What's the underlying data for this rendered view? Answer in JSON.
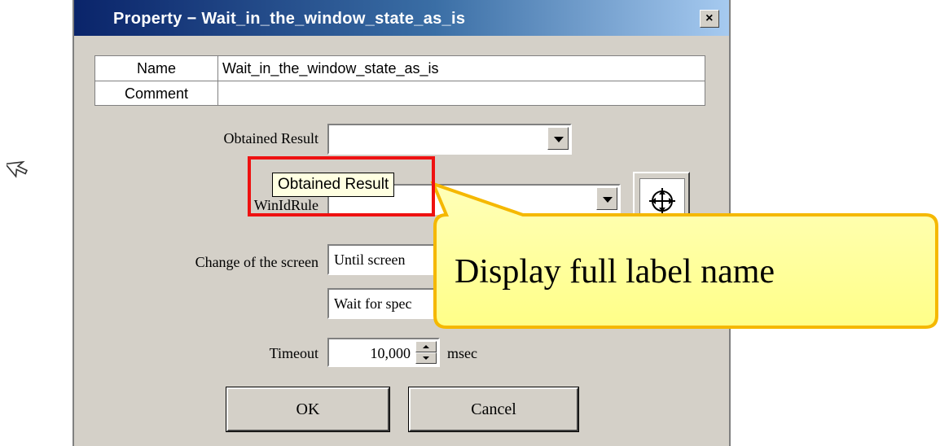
{
  "dialog": {
    "title": "Property − Wait_in_the_window_state_as_is",
    "close_label": "×"
  },
  "table": {
    "name_label": "Name",
    "name_value": "Wait_in_the_window_state_as_is",
    "comment_label": "Comment",
    "comment_value": ""
  },
  "form": {
    "obtained_result_label": "Obtained Result",
    "obtained_result_value": "",
    "winidrule_label": "WinIdRule",
    "winidrule_value": "",
    "change_label": "Change of the screen",
    "change_value_1": "Until screen",
    "change_value_2": "Wait for spec",
    "timeout_label": "Timeout",
    "timeout_value": "10,000",
    "timeout_unit": "msec"
  },
  "buttons": {
    "ok": "OK",
    "cancel": "Cancel"
  },
  "tooltip": {
    "text": "Obtained Result"
  },
  "callout": {
    "text": "Display full label name"
  },
  "colors": {
    "highlight": "#ee1111",
    "callout_fill": "#ffff99",
    "callout_border": "#f5b800",
    "title_start": "#0a246a"
  },
  "icons": {
    "cursor": "arrow-cursor-icon",
    "target": "crosshair-target-icon",
    "dropdown": "chevron-down-icon",
    "spinner": "spin-arrows-icon"
  }
}
